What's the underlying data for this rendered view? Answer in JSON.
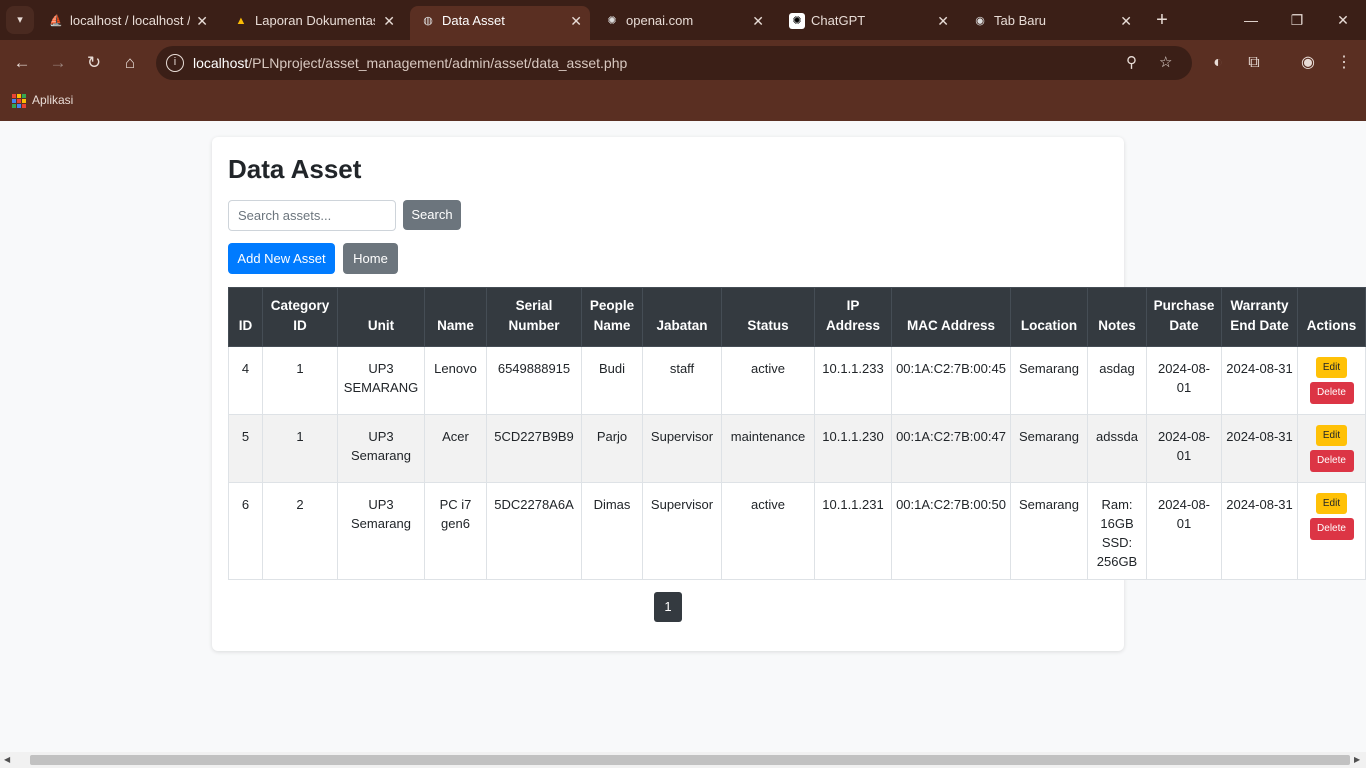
{
  "browser": {
    "tabs": [
      {
        "title": "localhost / localhost /",
        "icon": "phpmyadmin-icon"
      },
      {
        "title": "Laporan Dokumentasi",
        "icon": "google-drive-icon"
      },
      {
        "title": "Data Asset",
        "icon": "globe-icon",
        "active": true
      },
      {
        "title": "openai.com",
        "icon": "openai-icon"
      },
      {
        "title": "ChatGPT",
        "icon": "chatgpt-icon"
      },
      {
        "title": "Tab Baru",
        "icon": "chrome-icon"
      }
    ],
    "url_host": "localhost",
    "url_path": "/PLNproject/asset_management/admin/asset/data_asset.php",
    "bookmarks": {
      "apps_label": "Aplikasi"
    }
  },
  "page": {
    "title": "Data Asset",
    "search": {
      "placeholder": "Search assets...",
      "value": "",
      "button": "Search"
    },
    "add_button": "Add New Asset",
    "home_button": "Home",
    "table": {
      "headers": [
        "ID",
        "Category ID",
        "Unit",
        "Name",
        "Serial Number",
        "People Name",
        "Jabatan",
        "Status",
        "IP Address",
        "MAC Address",
        "Location",
        "Notes",
        "Purchase Date",
        "Warranty End Date",
        "Actions"
      ],
      "rows": [
        [
          "4",
          "1",
          "UP3 SEMARANG",
          "Lenovo",
          "6549888915",
          "Budi",
          "staff",
          "active",
          "10.1.1.233",
          "00:1A:C2:7B:00:45",
          "Semarang",
          "asdag",
          "2024-08-01",
          "2024-08-31"
        ],
        [
          "5",
          "1",
          "UP3 Semarang",
          "Acer",
          "5CD227B9B9",
          "Parjo",
          "Supervisor",
          "maintenance",
          "10.1.1.230",
          "00:1A:C2:7B:00:47",
          "Semarang",
          "adssda",
          "2024-08-01",
          "2024-08-31"
        ],
        [
          "6",
          "2",
          "UP3 Semarang",
          "PC i7 gen6",
          "5DC2278A6A",
          "Dimas",
          "Supervisor",
          "active",
          "10.1.1.231",
          "00:1A:C2:7B:00:50",
          "Semarang",
          "Ram: 16GB SSD: 256GB",
          "2024-08-01",
          "2024-08-31"
        ]
      ],
      "edit_label": "Edit",
      "delete_label": "Delete"
    },
    "pagination": {
      "current": "1"
    }
  },
  "colors": {
    "primary": "#007bff",
    "secondary": "#6c757d",
    "dark": "#343a40",
    "warning": "#ffc107",
    "danger": "#dc3545",
    "chrome": "#5a2f22"
  }
}
